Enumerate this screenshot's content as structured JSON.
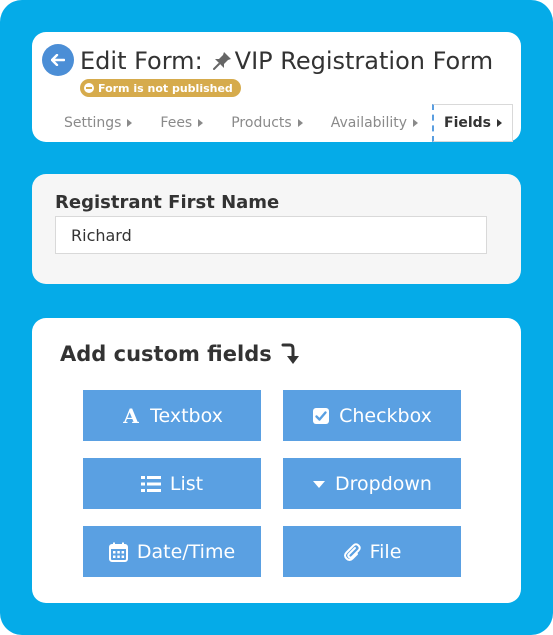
{
  "header": {
    "back_icon": "arrow-left-icon",
    "title_prefix": "Edit Form:",
    "pin_icon": "pushpin-icon",
    "form_name": "VIP Registration Form",
    "status": "Form is not published",
    "status_color": "#d6ab4c",
    "tabs": [
      {
        "label": "Settings",
        "active": false
      },
      {
        "label": "Fees",
        "active": false
      },
      {
        "label": "Products",
        "active": false
      },
      {
        "label": "Availability",
        "active": false
      },
      {
        "label": "Fields",
        "active": true
      }
    ]
  },
  "field": {
    "label": "Registrant First Name",
    "value": "Richard"
  },
  "custom_fields": {
    "title": "Add custom fields",
    "arrow_icon": "curved-arrow-down-icon",
    "accent": "#5aa0e2",
    "buttons": [
      {
        "label": "Textbox",
        "icon": "font-icon"
      },
      {
        "label": "Checkbox",
        "icon": "checkbox-icon"
      },
      {
        "label": "List",
        "icon": "list-icon"
      },
      {
        "label": "Dropdown",
        "icon": "caret-down-icon"
      },
      {
        "label": "Date/Time",
        "icon": "calendar-icon"
      },
      {
        "label": "File",
        "icon": "paperclip-icon"
      }
    ]
  },
  "colors": {
    "background": "#05abe8",
    "back_button": "#4b8ed6"
  }
}
